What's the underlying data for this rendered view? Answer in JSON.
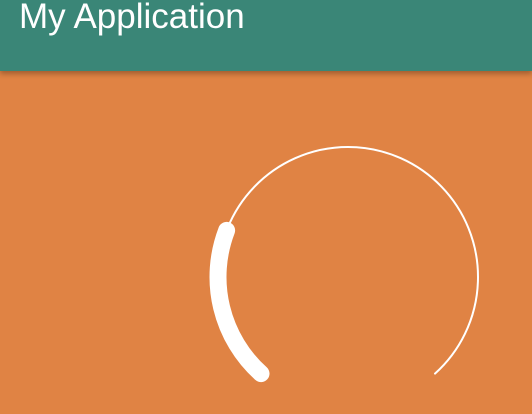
{
  "app_bar": {
    "title": "My Application"
  },
  "arc_progress": {
    "progress_fraction": 0.25,
    "track_color": "#FFFFFF",
    "progress_color": "#FFFFFF"
  },
  "colors": {
    "app_bar": "#3A8677",
    "background": "#E08344",
    "text_on_primary": "#FFFFFF"
  }
}
